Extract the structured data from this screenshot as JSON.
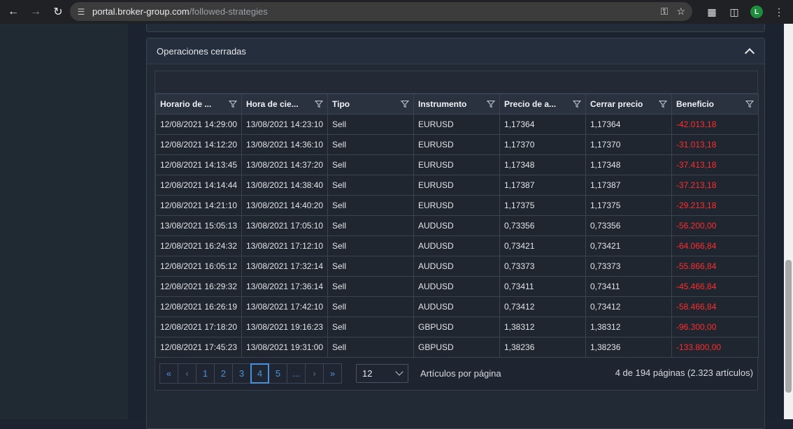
{
  "browser": {
    "url_host": "portal.broker-group.com",
    "url_path": "/followed-strategies",
    "profile_initial": "L"
  },
  "panel": {
    "title": "Operaciones cerradas"
  },
  "table": {
    "columns": [
      "Horario de ...",
      "Hora de cie...",
      "Tipo",
      "Instrumento",
      "Precio de a...",
      "Cerrar precio",
      "Beneficio"
    ],
    "rows": [
      [
        "12/08/2021 14:29:00",
        "13/08/2021 14:23:10",
        "Sell",
        "EURUSD",
        "1,17364",
        "1,17364",
        "-42.013,18"
      ],
      [
        "12/08/2021 14:12:20",
        "13/08/2021 14:36:10",
        "Sell",
        "EURUSD",
        "1,17370",
        "1,17370",
        "-31.013,18"
      ],
      [
        "12/08/2021 14:13:45",
        "13/08/2021 14:37:20",
        "Sell",
        "EURUSD",
        "1,17348",
        "1,17348",
        "-37.413,18"
      ],
      [
        "12/08/2021 14:14:44",
        "13/08/2021 14:38:40",
        "Sell",
        "EURUSD",
        "1,17387",
        "1,17387",
        "-37.213,18"
      ],
      [
        "12/08/2021 14:21:10",
        "13/08/2021 14:40:20",
        "Sell",
        "EURUSD",
        "1,17375",
        "1,17375",
        "-29.213,18"
      ],
      [
        "13/08/2021 15:05:13",
        "13/08/2021 17:05:10",
        "Sell",
        "AUDUSD",
        "0,73356",
        "0,73356",
        "-56.200,00"
      ],
      [
        "12/08/2021 16:24:32",
        "13/08/2021 17:12:10",
        "Sell",
        "AUDUSD",
        "0,73421",
        "0,73421",
        "-64.066,84"
      ],
      [
        "12/08/2021 16:05:12",
        "13/08/2021 17:32:14",
        "Sell",
        "AUDUSD",
        "0,73373",
        "0,73373",
        "-55.866,84"
      ],
      [
        "12/08/2021 16:29:32",
        "13/08/2021 17:36:14",
        "Sell",
        "AUDUSD",
        "0,73411",
        "0,73411",
        "-45.466,84"
      ],
      [
        "12/08/2021 16:26:19",
        "13/08/2021 17:42:10",
        "Sell",
        "AUDUSD",
        "0,73412",
        "0,73412",
        "-58.466,84"
      ],
      [
        "12/08/2021 17:18:20",
        "13/08/2021 19:16:23",
        "Sell",
        "GBPUSD",
        "1,38312",
        "1,38312",
        "-96.300,00"
      ],
      [
        "12/08/2021 17:45:23",
        "13/08/2021 19:31:00",
        "Sell",
        "GBPUSD",
        "1,38236",
        "1,38236",
        "-133.800,00"
      ]
    ]
  },
  "pager": {
    "first": "«",
    "prev": "‹",
    "pages": [
      "1",
      "2",
      "3",
      "4",
      "5",
      "..."
    ],
    "active_page": "4",
    "next": "›",
    "last": "»",
    "page_size": "12",
    "per_page_label": "Artículos por página",
    "info": "4 de 194 páginas (2.323 artículos)"
  },
  "colors": {
    "negative": "#ff2d2d",
    "accent": "#4c8fdc"
  }
}
